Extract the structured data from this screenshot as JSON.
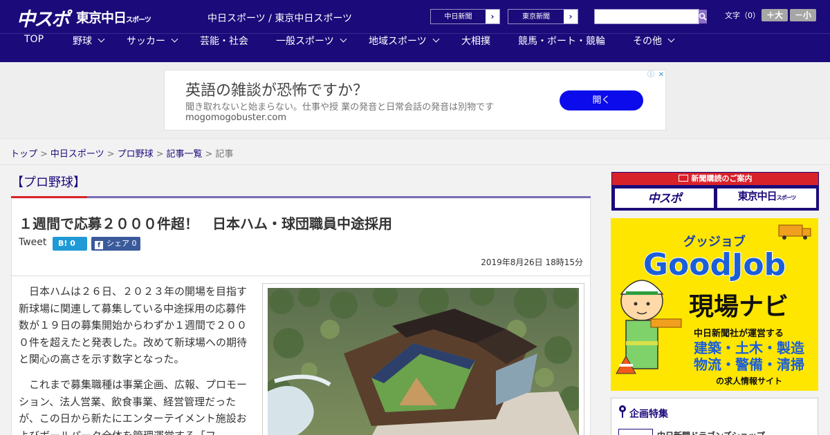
{
  "header": {
    "logo_chuspo": "中スポ",
    "logo_tokyo": "東京中日",
    "logo_tokyo_sub": "スポーツ",
    "site_name": "中日スポーツ / 東京中日スポーツ",
    "link_chunichi": "中日新聞",
    "link_tokyo": "東京新聞",
    "arrow": "›",
    "search_placeholder": "",
    "font_size_label": "文字（0）",
    "font_larger": "＋大",
    "font_smaller": "－小"
  },
  "nav": {
    "items": [
      {
        "label": "TOP"
      },
      {
        "label": "野球"
      },
      {
        "label": "サッカー"
      },
      {
        "label": "芸能・社会"
      },
      {
        "label": "一般スポーツ"
      },
      {
        "label": "地域スポーツ"
      },
      {
        "label": "大相撲"
      },
      {
        "label": "競馬・ボート・競輪"
      },
      {
        "label": "その他"
      }
    ]
  },
  "ad": {
    "headline": "英語の雑談が恐怖ですか？",
    "body": "聞き取れないと始まらない。仕事や授 業の発音と日常会話の発音は別物です",
    "url": "mogomogobuster.com",
    "button": "開く",
    "info_icon": "ⓘ",
    "close_icon": "✕"
  },
  "breadcrumb": {
    "items": [
      "トップ",
      "中日スポーツ",
      "プロ野球",
      "記事一覧"
    ],
    "current": "記事",
    "sep": ">"
  },
  "article": {
    "category": "【プロ野球】",
    "title": "１週間で応募２０００件超！　日本ハム・球団職員中途採用",
    "tweet_label": "Tweet",
    "hatena_label": "B! 0",
    "fb_icon": "f",
    "fb_label": "シェア 0",
    "date": "2019年8月26日 18時15分",
    "paragraphs": [
      "日本ハムは２６日、２０２３年の開場を目指す新球場に関連して募集している中途採用の応募件数が１９日の募集開始からわずか１週間で２０００件を超えたと発表した。改めて新球場への期待と関心の高さを示す数字となった。",
      "これまで募集職種は事業企画、広報、プロモーション、法人営業、飲食事業、経営管理だったが、この日から新たにエンターテイメント施設およびボールパーク全体を管理運営する「フ"
    ]
  },
  "sidebar": {
    "subscribe_title": "新聞購読のご案内",
    "subscribe_chuspo": "中スポ",
    "subscribe_tokyo": "東京中日",
    "subscribe_tokyo_sub": "スポーツ",
    "goodjob_kana": "グッジョブ",
    "goodjob_title": "GoodJob",
    "goodjob_sub": "現場ナビ",
    "goodjob_line1": "中日新聞社が運営する",
    "goodjob_line2": "建築・土木・製造",
    "goodjob_line3": "物流・警備・清掃",
    "goodjob_line4": "の求人情報サイト",
    "feature_title": "企画特集",
    "feature_item": "中日新聞ドラゴンズショップ"
  },
  "colors": {
    "brand_navy": "#1b0a7a",
    "accent_red": "#d8222a",
    "ad_button_blue": "#0b0bec",
    "goodjob_yellow": "#ffe600"
  }
}
